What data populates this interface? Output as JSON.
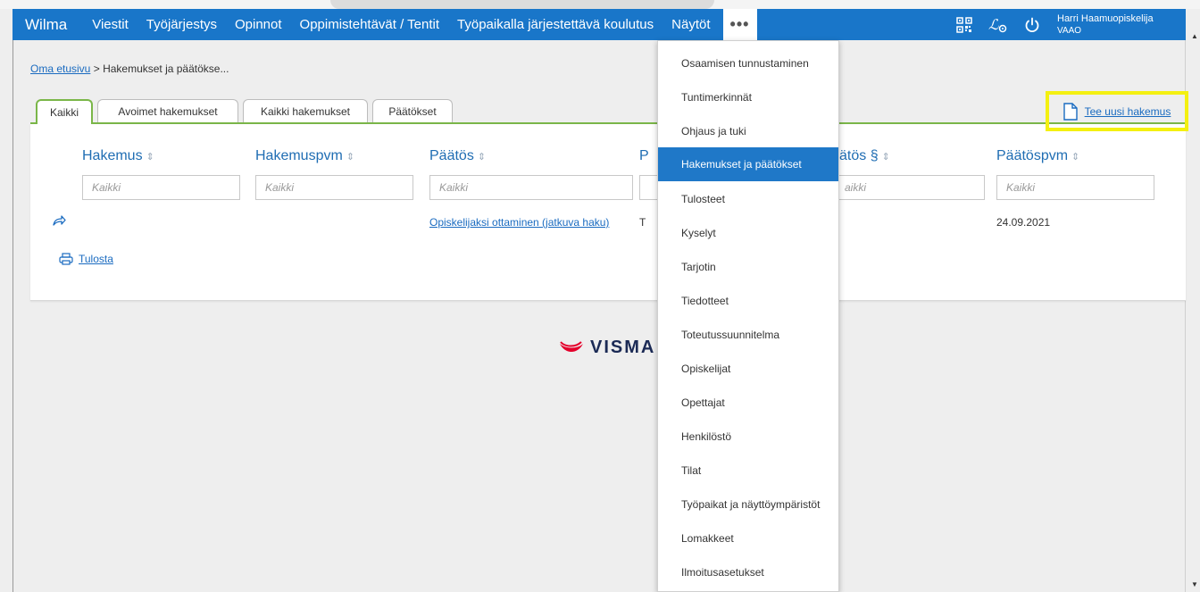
{
  "nav": {
    "brand": "Wilma",
    "items": [
      "Viestit",
      "Työjärjestys",
      "Opinnot",
      "Oppimistehtävät / Tentit",
      "Työpaikalla järjestettävä koulutus",
      "Näytöt"
    ],
    "more_label": "•••",
    "user_name": "Harri Haamuopiskelija",
    "user_role": "VAAO"
  },
  "breadcrumb": {
    "home": "Oma etusivu",
    "separator": ">",
    "current": "Hakemukset ja päätökse..."
  },
  "tabs": [
    "Kaikki",
    "Avoimet hakemukset",
    "Kaikki hakemukset",
    "Päätökset"
  ],
  "new_application": "Tee uusi hakemus",
  "table": {
    "columns": [
      "Hakemus",
      "Hakemuspvm",
      "Päätös",
      "P",
      "ätös §",
      "Päätöspvm"
    ],
    "filter_placeholder": "Kaikki",
    "filter_partial": "aikki",
    "row": {
      "decision": "Opiskelijaksi ottaminen (jatkuva haku)",
      "partial": "T",
      "date": "24.09.2021"
    }
  },
  "print_label": "Tulosta",
  "footer_logo": "VISMA",
  "dropdown": {
    "items": [
      "Osaamisen tunnustaminen",
      "Tuntimerkinnät",
      "Ohjaus ja tuki",
      "Hakemukset ja päätökset",
      "Tulosteet",
      "Kyselyt",
      "Tarjotin",
      "Tiedotteet",
      "Toteutussuunnitelma",
      "Opiskelijat",
      "Opettajat",
      "Henkilöstö",
      "Tilat",
      "Työpaikat ja näyttöympäristöt",
      "Lomakkeet",
      "Ilmoitusasetukset"
    ],
    "selected": "Hakemukset ja päätökset"
  },
  "colors": {
    "nav_blue": "#1976c9",
    "tab_green": "#7ab648",
    "highlight_yellow": "#f4f011",
    "link_blue": "#1a6bc0"
  }
}
